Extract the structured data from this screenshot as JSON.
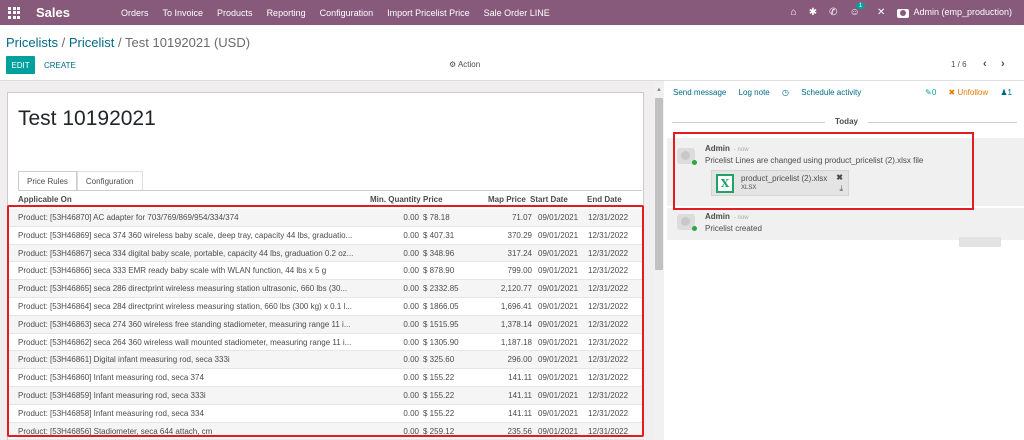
{
  "topbar": {
    "app_name": "Sales",
    "menu": [
      "Orders",
      "To Invoice",
      "Products",
      "Reporting",
      "Configuration",
      "Import Pricelist Price",
      "Sale Order LINE"
    ],
    "chat_badge": "1",
    "user": "Admin (emp_production)",
    "bg_color": "#875a7b"
  },
  "breadcrumb": {
    "level1": "Pricelists",
    "sep": "/",
    "level2": "Pricelist",
    "current": "Test 10192021 (USD)"
  },
  "buttons": {
    "edit": "EDIT",
    "create": "CREATE",
    "action": "Action"
  },
  "pager": {
    "text": "1 / 6",
    "prev": "‹",
    "next": "›"
  },
  "form": {
    "title": "Test 10192021",
    "tabs": [
      "Price Rules",
      "Configuration"
    ],
    "columns": [
      "Applicable On",
      "Min. Quantity",
      "Price",
      "Map Price",
      "Start Date",
      "End Date"
    ],
    "rows": [
      {
        "product": "Product: [53H46870] AC adapter for 703/769/869/954/334/374",
        "qty": "0.00",
        "price": "$ 78.18",
        "map": "71.07",
        "start": "09/01/2021",
        "end": "12/31/2022"
      },
      {
        "product": "Product: [53H46869] seca 374 360 wireless baby scale, deep tray, capacity 44 lbs, graduatio...",
        "qty": "0.00",
        "price": "$ 407.31",
        "map": "370.29",
        "start": "09/01/2021",
        "end": "12/31/2022"
      },
      {
        "product": "Product: [53H46867] seca 334 digital baby scale, portable, capacity 44 lbs, graduation 0.2 oz...",
        "qty": "0.00",
        "price": "$ 348.96",
        "map": "317.24",
        "start": "09/01/2021",
        "end": "12/31/2022"
      },
      {
        "product": "Product: [53H46866] seca 333 EMR ready baby scale with WLAN function, 44 lbs x 5 g",
        "qty": "0.00",
        "price": "$ 878.90",
        "map": "799.00",
        "start": "09/01/2021",
        "end": "12/31/2022"
      },
      {
        "product": "Product: [53H46865] seca 286 directprint wireless measuring station ultrasonic, 660 lbs (30...",
        "qty": "0.00",
        "price": "$ 2332.85",
        "map": "2,120.77",
        "start": "09/01/2021",
        "end": "12/31/2022"
      },
      {
        "product": "Product: [53H46864] seca 284 directprint wireless measuring station, 660 lbs (300 kg) x 0.1 l...",
        "qty": "0.00",
        "price": "$ 1866.05",
        "map": "1,696.41",
        "start": "09/01/2021",
        "end": "12/31/2022"
      },
      {
        "product": "Product: [53H46863] seca 274 360 wireless free standing stadiometer, measuring range 11 i...",
        "qty": "0.00",
        "price": "$ 1515.95",
        "map": "1,378.14",
        "start": "09/01/2021",
        "end": "12/31/2022"
      },
      {
        "product": "Product: [53H46862] seca 264 360 wireless wall mounted stadiometer, measuring range 11 i...",
        "qty": "0.00",
        "price": "$ 1305.90",
        "map": "1,187.18",
        "start": "09/01/2021",
        "end": "12/31/2022"
      },
      {
        "product": "Product: [53H46861] Digital infant measuring rod, seca 333i",
        "qty": "0.00",
        "price": "$ 325.60",
        "map": "296.00",
        "start": "09/01/2021",
        "end": "12/31/2022"
      },
      {
        "product": "Product: [53H46860] Infant measuring rod, seca 374",
        "qty": "0.00",
        "price": "$ 155.22",
        "map": "141.11",
        "start": "09/01/2021",
        "end": "12/31/2022"
      },
      {
        "product": "Product: [53H46859] Infant measuring rod, seca 333i",
        "qty": "0.00",
        "price": "$ 155.22",
        "map": "141.11",
        "start": "09/01/2021",
        "end": "12/31/2022"
      },
      {
        "product": "Product: [53H46858] Infant measuring rod, seca 334",
        "qty": "0.00",
        "price": "$ 155.22",
        "map": "141.11",
        "start": "09/01/2021",
        "end": "12/31/2022"
      },
      {
        "product": "Product: [53H46856] Stadiometer, seca 644 attach, cm",
        "qty": "0.00",
        "price": "$ 259.12",
        "map": "235.56",
        "start": "09/01/2021",
        "end": "12/31/2022"
      }
    ]
  },
  "chatter": {
    "send_message": "Send message",
    "log_note": "Log note",
    "schedule_activity": "Schedule activity",
    "followers_count": "0",
    "unfollow": "Unfollow",
    "people_count": "1",
    "today": "Today",
    "messages": [
      {
        "author": "Admin",
        "when": "- now",
        "body": "Pricelist Lines are changed using product_pricelist (2).xlsx file",
        "attachment": {
          "name": "product_pricelist (2).xlsx",
          "ext": "XLSX"
        }
      },
      {
        "author": "Admin",
        "when": "- now",
        "body": "Pricelist created"
      }
    ]
  },
  "colors": {
    "accent": "#00a09d",
    "link": "#006a86",
    "highlight": "#e51b24"
  }
}
